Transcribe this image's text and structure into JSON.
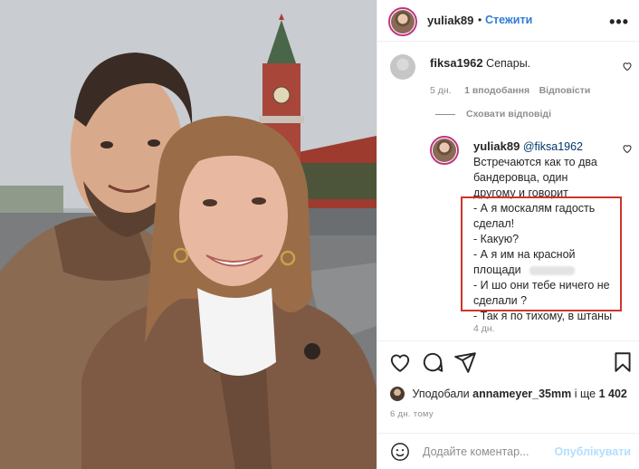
{
  "header": {
    "username": "yuliak89",
    "separator": "•",
    "follow_label": "Стежити",
    "more_icon": "more-horizontal-icon"
  },
  "comments": [
    {
      "username": "fiksa1962",
      "text": "Сепары.",
      "age": "5 дн.",
      "likes": "1 вподобання",
      "reply_label": "Відповісти"
    }
  ],
  "hide_replies_label": "Сховати відповіді",
  "reply": {
    "username": "yuliak89",
    "mention": "@fiksa1962",
    "lines": [
      "Встречаются как то два",
      "бандеровца, один",
      "другому и говорит",
      "- А я москалям гадость",
      "сделал!",
      "- Какую?",
      "- А я им на красной",
      "площади",
      "- И шо они тебе ничего не",
      "сделали ?",
      "- Так я по тихому, в штаны"
    ],
    "age": "4 дн."
  },
  "likes": {
    "prefix": "Уподобали",
    "user": "annameyer_35mm",
    "suffix": "і ще",
    "count": "1 402"
  },
  "time_ago": "6 дн. тому",
  "comment_box": {
    "placeholder": "Додайте коментар...",
    "publish_label": "Опублікувати"
  },
  "icons": [
    "heart-icon",
    "comment-icon",
    "share-icon",
    "bookmark-icon",
    "emoji-icon"
  ],
  "colors": {
    "follow": "#2f7bd6",
    "highlight_box": "#d0342c",
    "publish_disabled": "#b2dffc",
    "meta": "#8e8e8e"
  }
}
